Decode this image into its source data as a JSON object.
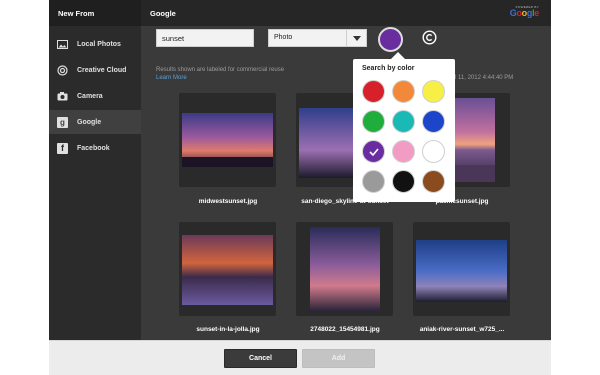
{
  "sidebar": {
    "title": "New From",
    "items": [
      {
        "label": "Local Photos",
        "icon": "image-icon"
      },
      {
        "label": "Creative Cloud",
        "icon": "creative-cloud-icon"
      },
      {
        "label": "Camera",
        "icon": "camera-icon"
      },
      {
        "label": "Google",
        "icon": "google-icon",
        "active": true
      },
      {
        "label": "Facebook",
        "icon": "facebook-icon"
      }
    ]
  },
  "header": {
    "title": "Google",
    "powered_by": "POWERED BY",
    "brand": "Google"
  },
  "search": {
    "value": "sunset"
  },
  "type_select": {
    "value": "Photo"
  },
  "selected_color": "#6a2d9f",
  "results_notice": {
    "line1": "Results shown are labeled for commercial reuse",
    "line2": "Google at April 11, 2012 4:44:40 PM",
    "learn_more": "Learn More"
  },
  "color_popover": {
    "title": "Search by color",
    "colors": [
      "#d6202a",
      "#f2893a",
      "#f7ee46",
      "#1fad3c",
      "#1bb9b5",
      "#1c45c9",
      "#6a2d9f",
      "#f29cc4",
      "#ffffff",
      "#9a9a9a",
      "#111111",
      "#8a4b1f"
    ],
    "selected_index": 6
  },
  "thumbnails": [
    {
      "filename": "midwestsunset.jpg"
    },
    {
      "filename": "san-diego_skyline-at-sunset"
    },
    {
      "filename": "pacificsunset.jpg"
    },
    {
      "filename": "sunset-in-la-jolla.jpg"
    },
    {
      "filename": "2748022_15454981.jpg"
    },
    {
      "filename": "aniak-river-sunset_w725_..."
    }
  ],
  "footer": {
    "cancel": "Cancel",
    "add": "Add"
  }
}
